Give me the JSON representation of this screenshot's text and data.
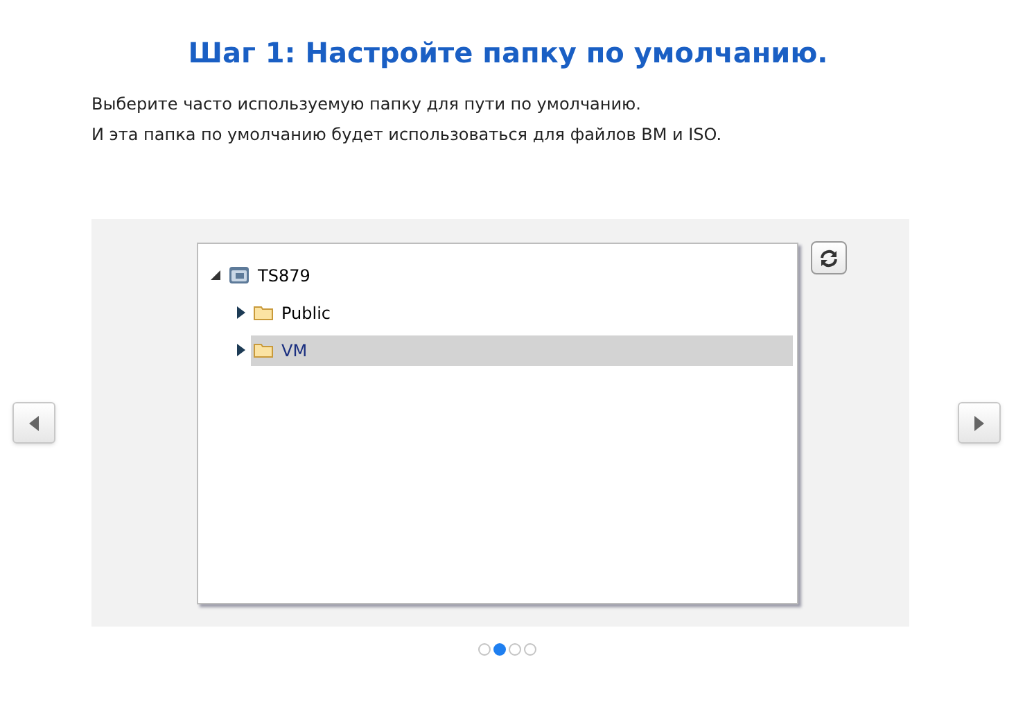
{
  "title": "Шаг 1: Настройте папку по умолчанию.",
  "description": [
    "Выберите часто используемую папку для пути по умолчанию.",
    "И эта папка по умолчанию будет использоваться для файлов ВМ и ISO."
  ],
  "tree": [
    {
      "label": "TS879",
      "kind": "server",
      "expanded": true,
      "selected": false,
      "children": [
        {
          "label": "Public",
          "kind": "folder",
          "expanded": false,
          "selected": false
        },
        {
          "label": "VM",
          "kind": "folder",
          "expanded": false,
          "selected": true
        }
      ]
    }
  ],
  "pager": [
    {
      "selected": false
    },
    {
      "selected": true
    },
    {
      "selected": false
    },
    {
      "selected": false
    }
  ]
}
